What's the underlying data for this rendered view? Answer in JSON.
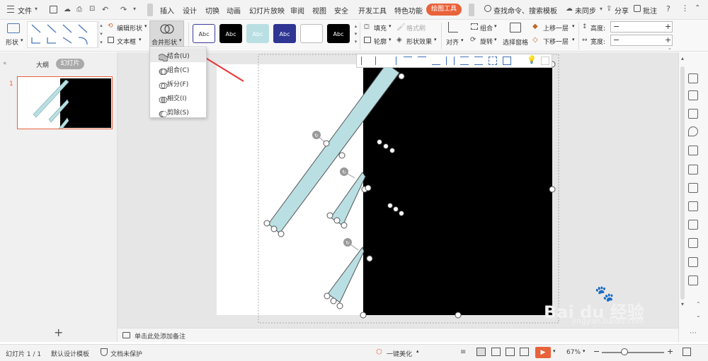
{
  "menubar": {
    "file_label": "文件",
    "tabs": [
      "插入",
      "设计",
      "切换",
      "动画",
      "幻灯片放映",
      "审阅",
      "视图",
      "安全",
      "开发工具",
      "特色功能"
    ],
    "active_tab": "绘图工具",
    "search_label": "查找命令、搜索模板",
    "sync_label": "未同步",
    "share_label": "分享",
    "comment_label": "批注"
  },
  "ribbon": {
    "shape_label": "形状",
    "edit_shape_label": "编辑形状",
    "textbox_label": "文本框",
    "merge_shapes_label": "合并形状",
    "style_swatches": [
      {
        "text": "Abc",
        "bg": "#ffffff",
        "fg": "#333333",
        "border": "#3b3b9e"
      },
      {
        "text": "Abc",
        "bg": "#000000",
        "fg": "#ffffff",
        "border": "#000000"
      },
      {
        "text": "Abc",
        "bg": "#b9dfe3",
        "fg": "#ffffff",
        "border": "#b9dfe3"
      },
      {
        "text": "Abc",
        "bg": "#2f3593",
        "fg": "#ffffff",
        "border": "#2f3593"
      },
      {
        "text": "",
        "bg": "#ffffff",
        "fg": "#333333",
        "border": "#bbbbbb"
      },
      {
        "text": "Abc",
        "bg": "#000000",
        "fg": "#ffffff",
        "border": "#000000"
      }
    ],
    "fill_label": "填充",
    "format_painter_label": "格式刷",
    "outline_label": "轮廓",
    "shape_effect_label": "形状效果",
    "align_label": "对齐",
    "group_label": "组合",
    "rotate_label": "旋转",
    "selection_pane_label": "选择窗格",
    "bring_forward_label": "上移一层",
    "send_backward_label": "下移一层",
    "height_label": "高度:",
    "width_label": "宽度:"
  },
  "dropdown": {
    "items": [
      {
        "label": "结合(U)",
        "icon": "union-icon"
      },
      {
        "label": "组合(C)",
        "icon": "combine-icon"
      },
      {
        "label": "拆分(F)",
        "icon": "fragment-icon"
      },
      {
        "label": "相交(I)",
        "icon": "intersect-icon"
      },
      {
        "label": "剪除(S)",
        "icon": "subtract-icon"
      }
    ]
  },
  "leftpanel": {
    "outline_tab": "大纲",
    "slides_tab": "幻灯片",
    "slide_number": "1",
    "add_slide": "+"
  },
  "notes": {
    "placeholder": "单击此处添加备注"
  },
  "statusbar": {
    "slide_info": "幻灯片 1 / 1",
    "template": "默认设计模板",
    "protect": "文档未保护",
    "beautify": "一键美化",
    "zoom": "67%"
  },
  "watermark": {
    "brand_text": "Bai du 经验",
    "url_text": "jingyan.baidu.com"
  },
  "colors": {
    "accent_orange": "#e8623a",
    "shape_fill": "#b9dfe3",
    "arrow_red": "#e8393a"
  }
}
